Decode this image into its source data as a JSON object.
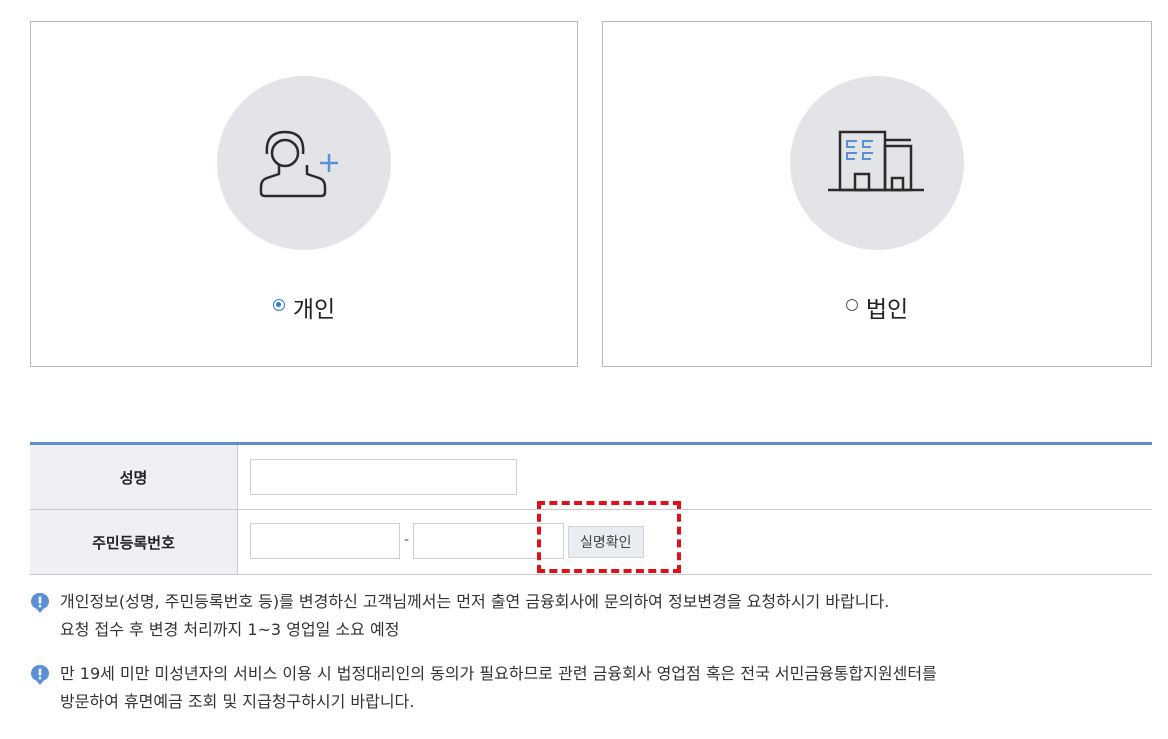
{
  "cards": {
    "personal": {
      "label": "개인",
      "selected": true,
      "icon": "person-add-icon"
    },
    "corporate": {
      "label": "법인",
      "selected": false,
      "icon": "building-icon"
    }
  },
  "form": {
    "name_label": "성명",
    "rrn_label": "주민등록번호",
    "rrn_separator": "-",
    "verify_button": "실명확인"
  },
  "notices": [
    {
      "line1": "개인정보(성명, 주민등록번호 등)를 변경하신 고객님께서는 먼저 출연 금융회사에 문의하여 정보변경을 요청하시기 바랍니다.",
      "line2": "요청 접수 후 변경 처리까지 1~3 영업일 소요 예정"
    },
    {
      "line1": "만 19세 미만 미성년자의 서비스 이용 시 법정대리인의 동의가 필요하므로 관련 금융회사 영업점 혹은 전국 서민금융통합지원센터를",
      "line2": "방문하여 휴면예금 조회 및 지급청구하시기 바랍니다."
    }
  ],
  "colors": {
    "accent": "#2f7de1",
    "table_top_border": "#5f8fd3",
    "header_bg": "#eef0f3",
    "icon_circle": "#e3e4e8",
    "notice_icon": "#5b8fd6",
    "highlight": "#e0101a"
  }
}
